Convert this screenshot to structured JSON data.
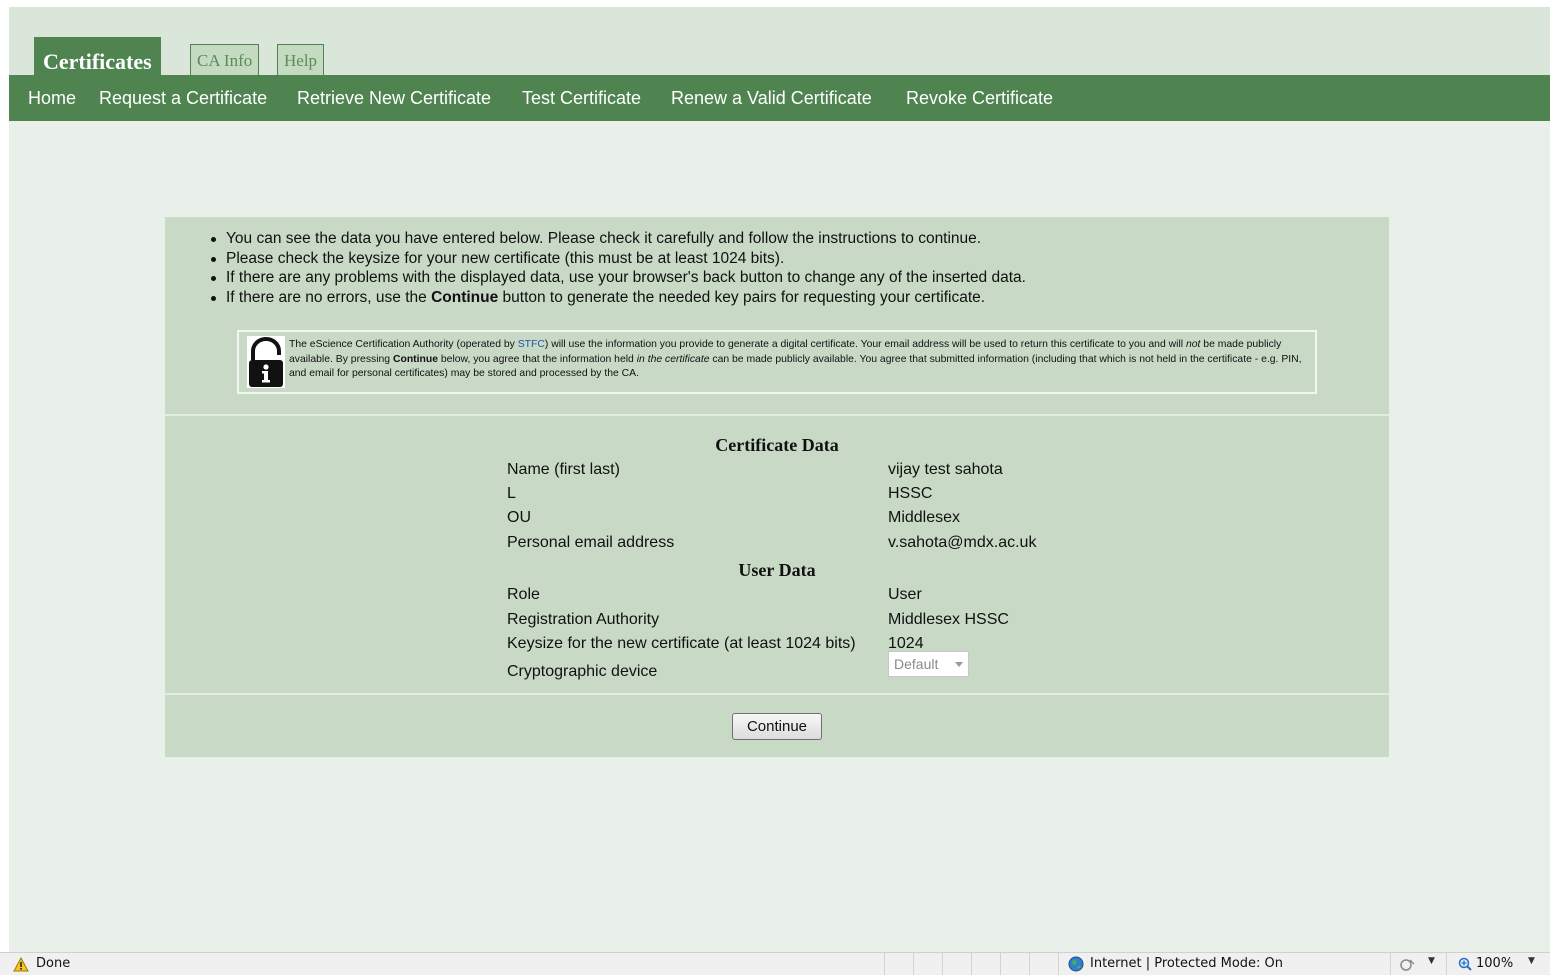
{
  "tabs": [
    {
      "label": "Certificates",
      "active": true
    },
    {
      "label": "CA Info",
      "active": false
    },
    {
      "label": "Help",
      "active": false
    }
  ],
  "menu": [
    "Home",
    "Request a Certificate",
    "Retrieve New Certificate",
    "Test Certificate",
    "Renew a Valid Certificate",
    "Revoke Certificate"
  ],
  "instructions": {
    "item1": "You can see the data you have entered below. Please check it carefully and follow the instructions to continue.",
    "item2": "Please check the keysize for your new certificate (this must be at least 1024 bits).",
    "item3": "If there are any problems with the displayed data, use your browser's back button to change any of the inserted data.",
    "item4_before": "If there are no errors, use the ",
    "item4_bold": "Continue",
    "item4_after": " button to generate the needed key pairs for requesting your certificate."
  },
  "privacy": {
    "p1": "The eScience Certification Authority (operated by ",
    "link": "STFC",
    "p2": ") will use the information you provide to generate a digital certificate. Your email address will be used to return this certificate to you and will ",
    "em1": "not",
    "p3": " be made publicly available. By pressing ",
    "bold1": "Continue",
    "p4": " below, you agree that the information held ",
    "em2": "in the certificate",
    "p5": " can be made publicly available. You agree that submitted information (including that which is not held in the certificate - e.g. PIN, and email for personal certificates) may be stored and processed by the CA."
  },
  "certificate_data": {
    "title": "Certificate Data",
    "rows": [
      {
        "label": "Name (first last)",
        "value": "vijay test sahota"
      },
      {
        "label": "L",
        "value": "HSSC"
      },
      {
        "label": "OU",
        "value": "Middlesex"
      },
      {
        "label": "Personal email address",
        "value": "v.sahota@mdx.ac.uk"
      }
    ]
  },
  "user_data": {
    "title": "User Data",
    "rows": [
      {
        "label": "Role",
        "value": "User"
      },
      {
        "label": "Registration Authority",
        "value": "Middlesex HSSC"
      },
      {
        "label": "Keysize for the new certificate (at least 1024 bits)",
        "value": "1024"
      }
    ],
    "device_label": "Cryptographic device",
    "device_value": "Default"
  },
  "continue_label": "Continue",
  "statusbar": {
    "status": "Done",
    "zone": "Internet | Protected Mode: On",
    "zoom": "100%"
  },
  "colors": {
    "menu_green": "#4f8451",
    "panel_green": "#c8dac6",
    "page_bg": "#e9f0e9"
  }
}
